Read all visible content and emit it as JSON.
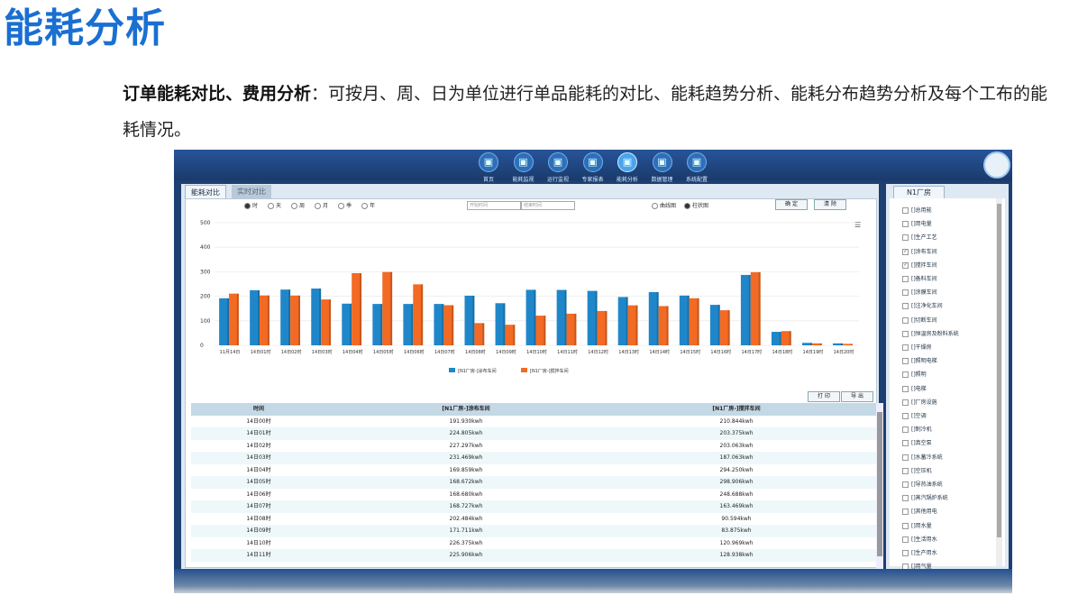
{
  "page": {
    "title": "能耗分析",
    "desc_bold": "订单能耗对比、费用分析",
    "desc_text": "：可按月、周、日为单位进行单品能耗的对比、能耗趋势分析、能耗分布趋势分析及每个工布的能耗情况。"
  },
  "app": {
    "nav": [
      {
        "label": "首页",
        "icon": "home-icon"
      },
      {
        "label": "能耗监视",
        "icon": "chart-icon"
      },
      {
        "label": "运行监视",
        "icon": "gauge-icon"
      },
      {
        "label": "专家报表",
        "icon": "report-icon"
      },
      {
        "label": "能耗分析",
        "icon": "analysis-icon",
        "active": true
      },
      {
        "label": "数据管理",
        "icon": "database-icon"
      },
      {
        "label": "系统配置",
        "icon": "settings-icon"
      }
    ],
    "tabs": [
      "能耗对比",
      "实时对比"
    ],
    "period_options": [
      "时",
      "天",
      "周",
      "月",
      "季",
      "年"
    ],
    "start_placeholder": "开始时间",
    "end_placeholder": "结束时间",
    "chart_options": [
      "曲线图",
      "柱状图"
    ],
    "confirm_label": "确 定",
    "clear_label": "清 除",
    "print_label": "打 印",
    "export_label": "导 出",
    "table": {
      "headers": [
        "时间",
        "[N1厂房-]涂布车间",
        "[N1厂房-]搅拌车间"
      ],
      "rows": [
        [
          "14日00时",
          "191.930kwh",
          "210.844kwh"
        ],
        [
          "14日01时",
          "224.805kwh",
          "203.375kwh"
        ],
        [
          "14日02时",
          "227.297kwh",
          "203.063kwh"
        ],
        [
          "14日03时",
          "231.469kwh",
          "187.063kwh"
        ],
        [
          "14日04时",
          "169.859kwh",
          "294.250kwh"
        ],
        [
          "14日05时",
          "168.672kwh",
          "298.906kwh"
        ],
        [
          "14日06时",
          "168.680kwh",
          "248.688kwh"
        ],
        [
          "14日07时",
          "168.727kwh",
          "163.469kwh"
        ],
        [
          "14日08时",
          "202.484kwh",
          "90.594kwh"
        ],
        [
          "14日09时",
          "171.711kwh",
          "83.875kwh"
        ],
        [
          "14日10时",
          "226.375kwh",
          "120.969kwh"
        ],
        [
          "14日11时",
          "225.906kwh",
          "128.938kwh"
        ]
      ]
    },
    "tree": {
      "title": "N1厂房",
      "items": [
        {
          "label": "[]总用能",
          "checked": false
        },
        {
          "label": "[]用电量",
          "checked": false
        },
        {
          "label": "[]生产工艺",
          "checked": false
        },
        {
          "label": "[]涂布车间",
          "checked": true
        },
        {
          "label": "[]搅拌车间",
          "checked": true
        },
        {
          "label": "[]备料车间",
          "checked": false
        },
        {
          "label": "[]涂膜车间",
          "checked": false
        },
        {
          "label": "[]注净化车间",
          "checked": false
        },
        {
          "label": "[]切断车间",
          "checked": false
        },
        {
          "label": "[]恒温房及粉料系统",
          "checked": false
        },
        {
          "label": "[]干燥房",
          "checked": false
        },
        {
          "label": "[]照明电梯",
          "checked": false
        },
        {
          "label": "[]照明",
          "checked": false
        },
        {
          "label": "[]电梯",
          "checked": false
        },
        {
          "label": "[]厂房设施",
          "checked": false
        },
        {
          "label": "[]空调",
          "checked": false
        },
        {
          "label": "[]制冷机",
          "checked": false
        },
        {
          "label": "[]真空泵",
          "checked": false
        },
        {
          "label": "[]水蓄冷系统",
          "checked": false
        },
        {
          "label": "[]空压机",
          "checked": false
        },
        {
          "label": "[]导热油系统",
          "checked": false
        },
        {
          "label": "[]蒸汽锅炉系统",
          "checked": false
        },
        {
          "label": "[]其他用电",
          "checked": false
        },
        {
          "label": "[]用水量",
          "checked": false
        },
        {
          "label": "[]生活用水",
          "checked": false
        },
        {
          "label": "[]生产用水",
          "checked": false
        },
        {
          "label": "[]用气量",
          "checked": false
        }
      ]
    }
  },
  "chart_data": {
    "type": "bar",
    "categories": [
      "11月14日",
      "14日01时",
      "14日02时",
      "14日03时",
      "14日04时",
      "14日05时",
      "14日06时",
      "14日07时",
      "14日08时",
      "14日09时",
      "14日10时",
      "14日11时",
      "14日12时",
      "14日13时",
      "14日14时",
      "14日15时",
      "14日16时",
      "14日17时",
      "14日18时",
      "14日19时",
      "14日20时"
    ],
    "series": [
      {
        "name": "[N1厂房-]涂布车间",
        "color": "#1f87c9",
        "values": [
          191.9,
          224.8,
          227.3,
          231.5,
          169.9,
          168.7,
          168.7,
          168.7,
          202.5,
          171.7,
          226.4,
          225.9,
          222,
          197,
          217,
          203,
          165,
          287,
          55,
          10,
          8
        ]
      },
      {
        "name": "[N1厂房-]搅拌车间",
        "color": "#f26a23",
        "values": [
          210.8,
          203.4,
          203.1,
          187.1,
          294.3,
          298.9,
          248.7,
          163.5,
          90.6,
          83.9,
          121.0,
          128.9,
          140,
          163,
          160,
          192,
          143,
          298,
          58,
          8,
          6
        ]
      }
    ],
    "ylim": [
      0,
      500
    ],
    "yticks": [
      0,
      100,
      200,
      300,
      400,
      500
    ],
    "grid": true,
    "legend": "bottom"
  }
}
